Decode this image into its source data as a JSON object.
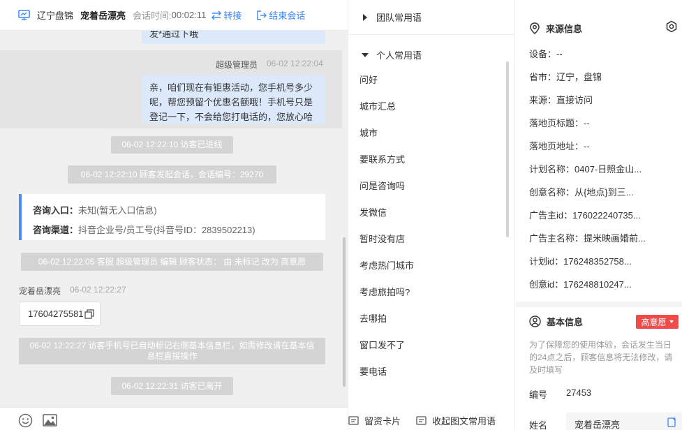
{
  "header": {
    "location": "辽宁盘锦",
    "customer_name": "宠着岳漂亮",
    "session_time_label": "会话时间:",
    "session_time": "00:02:11",
    "transfer_label": "转接",
    "end_label": "结束会话"
  },
  "messages": {
    "top_fragment": "发*通过下哦",
    "agent_name": "超级管理员",
    "agent_time": "06-02 12:22:04",
    "agent_text": "亲，咱们现在有钜惠活动，您手机号多少呢，帮您预留个优惠名额哦！手机号只是登记一下，不会给您打电话的，您放心哈",
    "sys_visitor_enter": "06-02 12:22:10 访客已进线",
    "sys_session_start": "06-02 12:22:10 顾客发起会话，会话编号：29270",
    "consult_entry_label": "咨询入口：",
    "consult_entry_value": "未知(暂无入口信息)",
    "consult_channel_label": "咨询渠道：",
    "consult_channel_value": "抖音企业号/员工号(抖音号ID：2839502213)",
    "sys_status_change": "06-02 12:22:05 客服 超级管理员 编辑 顾客状态： 由 未标记 改为 高意愿",
    "visitor_name": "宠着岳漂亮",
    "visitor_time": "06-02 12:22:27",
    "visitor_phone": "17604275581",
    "sys_auto_mark": "06-02 12:22:27 访客手机号已自动标记右侧基本信息栏，如需修改请在基本信息栏直接操作",
    "sys_visitor_leave": "06-02 12:22:31 访客已离开"
  },
  "phrases": {
    "team_group": "团队常用语",
    "personal_group": "个人常用语",
    "items": [
      "问好",
      "城市汇总",
      "城市",
      "要联系方式",
      "问是咨询吗",
      "发微信",
      "暂时没有店",
      "考虑热门城市",
      "考虑旅拍吗?",
      "去哪拍",
      "窗口发不了",
      "要电话"
    ],
    "card_button": "留资卡片",
    "collapse_button": "收起图文常用语"
  },
  "source_info": {
    "title": "来源信息",
    "rows": [
      "设备：--",
      "省市：辽宁，盘锦",
      "来源：直接访问",
      "落地页标题：--",
      "落地页地址：--",
      "计划名称：0407-日照金山...",
      "创意名称：从{地点}到三...",
      "广告主id：176022240735...",
      "广告主名称：提米映画婚前...",
      "计划id：176248352758...",
      "创意id：176248810247..."
    ]
  },
  "basic_info": {
    "title": "基本信息",
    "level": "高意愿",
    "note": "为了保障您的使用体验，会话发生当日的24点之后，顾客信息将无法修改，请及时填写",
    "number_label": "编号",
    "number_value": "27453",
    "name_label": "姓名",
    "name_value": "宠着岳漂亮"
  },
  "colors": {
    "accent": "#3a86f5",
    "level_tag": "#ef4b4b",
    "agent_bubble": "#dce9fb",
    "system_message": "#d4d4d4"
  },
  "icons": [
    "monitor-icon",
    "transfer-icon",
    "exit-icon",
    "copy-icon",
    "emoji-icon",
    "image-icon",
    "caret-right-icon",
    "caret-down-icon",
    "card-icon",
    "collapse-icon",
    "location-pin-icon",
    "settings-icon",
    "user-circle-icon"
  ]
}
